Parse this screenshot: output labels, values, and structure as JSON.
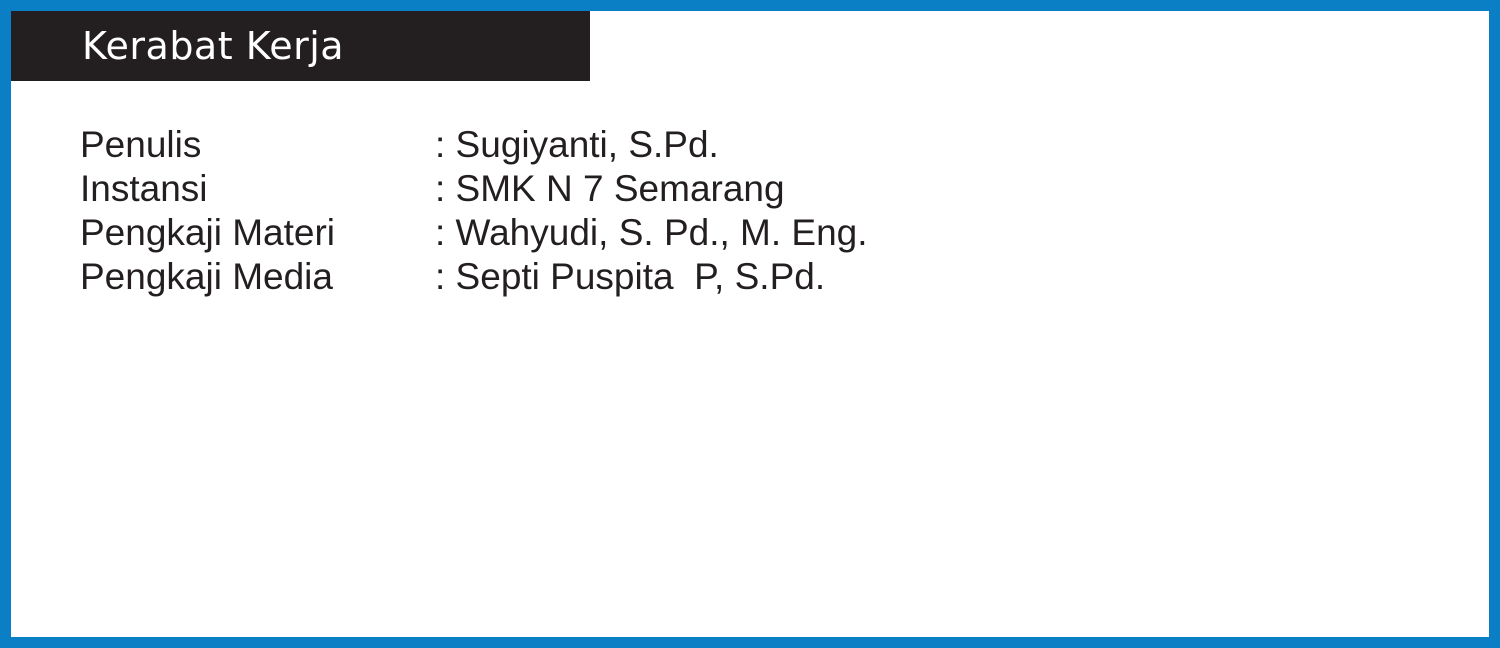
{
  "header": {
    "title": "Kerabat Kerja"
  },
  "credits": [
    {
      "label": "Penulis",
      "value": ": Sugiyanti, S.Pd."
    },
    {
      "label": "Instansi",
      "value": ": SMK N 7 Semarang"
    },
    {
      "label": "Pengkaji Materi",
      "value": ": Wahyudi, S. Pd., M. Eng."
    },
    {
      "label": "Pengkaji Media",
      "value": ": Septi Puspita  P, S.Pd."
    }
  ],
  "colors": {
    "border": "#0a7fc5",
    "header_background": "#231f20",
    "header_text": "#ffffff",
    "body_text": "#231f20",
    "background": "#ffffff"
  }
}
